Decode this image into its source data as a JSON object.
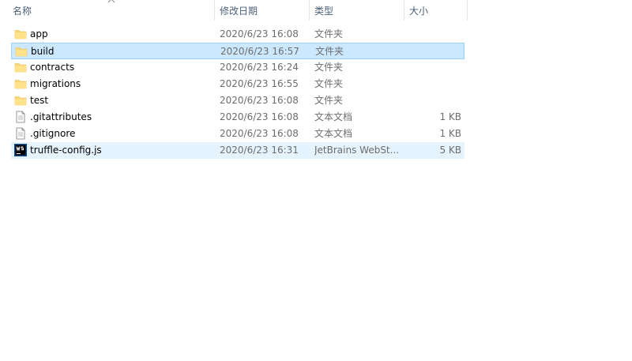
{
  "columns": {
    "name": "名称",
    "date": "修改日期",
    "type": "类型",
    "size": "大小"
  },
  "files": [
    {
      "name": "app",
      "date": "2020/6/23 16:08",
      "type": "文件夹",
      "size": "",
      "icon": "folder-icon",
      "state": "normal"
    },
    {
      "name": "build",
      "date": "2020/6/23 16:57",
      "type": "文件夹",
      "size": "",
      "icon": "folder-icon",
      "state": "selected"
    },
    {
      "name": "contracts",
      "date": "2020/6/23 16:24",
      "type": "文件夹",
      "size": "",
      "icon": "folder-icon",
      "state": "normal"
    },
    {
      "name": "migrations",
      "date": "2020/6/23 16:55",
      "type": "文件夹",
      "size": "",
      "icon": "folder-icon",
      "state": "normal"
    },
    {
      "name": "test",
      "date": "2020/6/23 16:08",
      "type": "文件夹",
      "size": "",
      "icon": "folder-icon",
      "state": "normal"
    },
    {
      "name": ".gitattributes",
      "date": "2020/6/23 16:08",
      "type": "文本文档",
      "size": "1 KB",
      "icon": "text-file-icon",
      "state": "normal"
    },
    {
      "name": ".gitignore",
      "date": "2020/6/23 16:08",
      "type": "文本文档",
      "size": "1 KB",
      "icon": "text-file-icon",
      "state": "normal"
    },
    {
      "name": "truffle-config.js",
      "date": "2020/6/23 16:31",
      "type": "JetBrains WebSt...",
      "size": "5 KB",
      "icon": "webstorm-icon",
      "state": "hover"
    }
  ],
  "colors": {
    "selected_bg": "#cce8ff",
    "hover_bg": "#e5f3ff",
    "folder": "#f8d775"
  }
}
